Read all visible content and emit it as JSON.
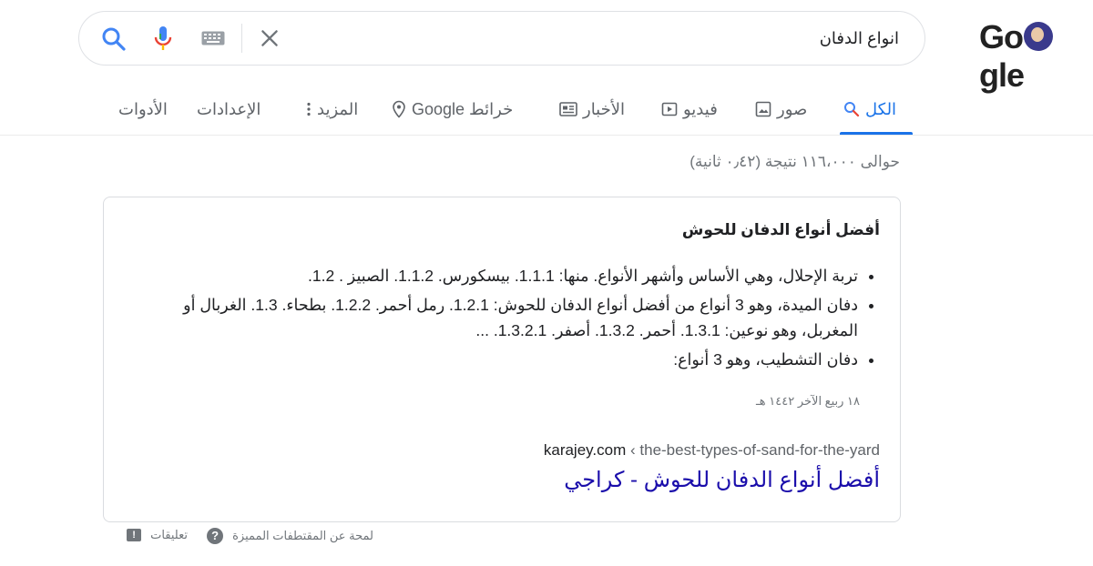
{
  "logo": {
    "text": "Google"
  },
  "search": {
    "query": "انواع الدفان"
  },
  "tabs": [
    {
      "label": "الكل",
      "icon": "search-icon",
      "active": true
    },
    {
      "label": "صور",
      "icon": "image-icon"
    },
    {
      "label": "فيديو",
      "icon": "video-icon"
    },
    {
      "label": "الأخبار",
      "icon": "news-icon"
    },
    {
      "label": "خرائط Google",
      "icon": "map-pin-icon"
    },
    {
      "label": "المزيد",
      "icon": "more-vert-icon"
    },
    {
      "label": "الإعدادات"
    },
    {
      "label": "الأدوات"
    }
  ],
  "result_stats": "حوالى ١١٦،٠٠٠ نتيجة (٠٫٤٢ ثانية)",
  "snippet": {
    "heading": "أفضل أنواع الدفان للحوش",
    "bullets": [
      "تربة الإحلال، وهي الأساس وأشهر الأنواع. منها: 1.1.1. بيسكورس. 1.1.2. الصبيز . 1.2.",
      "دفان الميدة، وهو 3 أنواع من أفضل أنواع الدفان للحوش: 1.2.1. رمل أحمر. 1.2.2. بطحاء. 1.3. الغربال أو المغربل، وهو نوعين: 1.3.1. أحمر. 1.3.2. أصفر. 1.3.2.1. ...",
      "دفان التشطيب، وهو 3 أنواع:"
    ],
    "date": "١٨ ربيع الآخر ١٤٤٢ هـ",
    "domain": "karajey.com",
    "path": "the-best-types-of-sand-for-the-yard",
    "separator": "‹",
    "link_title": "أفضل أنواع الدفان للحوش - كراجي"
  },
  "footer": {
    "about_featured": "لمحة عن المقتطفات المميزة",
    "feedback": "تعليقات"
  },
  "colors": {
    "active_tab": "#1a73e8",
    "link": "#1a0dab",
    "muted": "#70757a"
  }
}
